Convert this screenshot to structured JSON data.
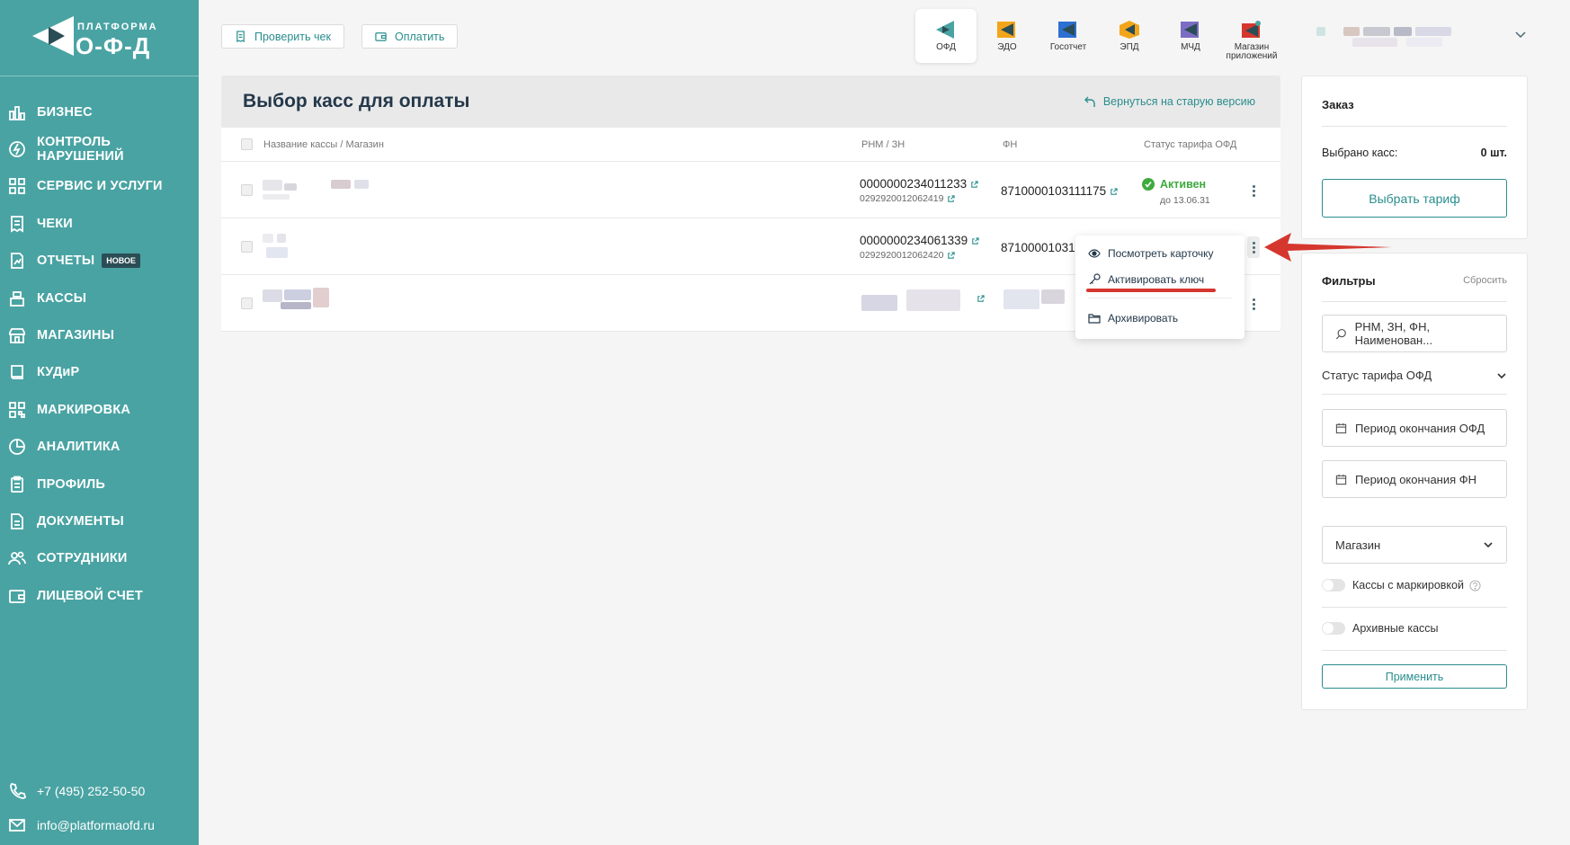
{
  "brand": {
    "top": "ПЛАТФОРМА",
    "main": "О-Ф-Д"
  },
  "sidebar": {
    "items": [
      {
        "label": "БИЗНЕС",
        "icon": "bar-chart-icon"
      },
      {
        "label": "КОНТРОЛЬ НАРУШЕНИЙ",
        "icon": "lightning-icon"
      },
      {
        "label": "СЕРВИС И УСЛУГИ",
        "icon": "grid-icon"
      },
      {
        "label": "ЧЕКИ",
        "icon": "receipt-icon"
      },
      {
        "label": "ОТЧЕТЫ",
        "icon": "report-icon",
        "badge": "НОВОЕ"
      },
      {
        "label": "КАССЫ",
        "icon": "cash-register-icon"
      },
      {
        "label": "МАГАЗИНЫ",
        "icon": "store-icon"
      },
      {
        "label": "КУДиР",
        "icon": "book-icon"
      },
      {
        "label": "МАРКИРОВКА",
        "icon": "qr-icon"
      },
      {
        "label": "АНАЛИТИКА",
        "icon": "pie-icon"
      },
      {
        "label": "ПРОФИЛЬ",
        "icon": "clipboard-icon"
      },
      {
        "label": "ДОКУМЕНТЫ",
        "icon": "document-icon"
      },
      {
        "label": "СОТРУДНИКИ",
        "icon": "users-icon"
      },
      {
        "label": "ЛИЦЕВОЙ СЧЕТ",
        "icon": "wallet-icon"
      }
    ],
    "phone": "+7 (495) 252-50-50",
    "email": "info@platformaofd.ru"
  },
  "toolbar": {
    "check_label": "Проверить чек",
    "pay_label": "Оплатить"
  },
  "apps": [
    {
      "label": "ОФД",
      "active": true
    },
    {
      "label": "ЭДО"
    },
    {
      "label": "Госотчет"
    },
    {
      "label": "ЭПД"
    },
    {
      "label": "МЧД"
    },
    {
      "label": "Магазин приложений"
    }
  ],
  "page": {
    "title": "Выбор касс для оплаты",
    "back_link": "Вернуться на старую версию"
  },
  "table": {
    "headers": {
      "name": "Название кассы / Магазин",
      "rnm": "РНМ / ЗН",
      "fn": "ФН",
      "status": "Статус тарифа ОФД"
    },
    "rows": [
      {
        "rnm": "0000000234011233",
        "zn": "0292920012062419",
        "fn": "8710000103111175",
        "status": "Активен",
        "until": "до 13.06.31"
      },
      {
        "rnm": "0000000234061339",
        "zn": "0292920012062420",
        "fn": "87100001031"
      },
      {}
    ]
  },
  "menu": {
    "view": "Посмотреть карточку",
    "activate": "Активировать ключ",
    "archive": "Архивировать"
  },
  "order": {
    "title": "Заказ",
    "selected_label": "Выбрано касс:",
    "selected_value": "0 шт.",
    "button": "Выбрать тариф"
  },
  "filters": {
    "title": "Фильтры",
    "reset": "Сбросить",
    "search_placeholder": "РНМ, ЗН, ФН, Наименован...",
    "tariff_status": "Статус тарифа ОФД",
    "period_ofd": "Период окончания ОФД",
    "period_fn": "Период окончания ФН",
    "store": "Магазин",
    "marking": "Кассы с маркировкой",
    "archived": "Архивные кассы",
    "apply": "Применить"
  },
  "colors": {
    "sidebar": "#4aa3a3",
    "accent": "#2a8d8d",
    "active": "#3eaa3e",
    "arrow": "#d5372e"
  }
}
